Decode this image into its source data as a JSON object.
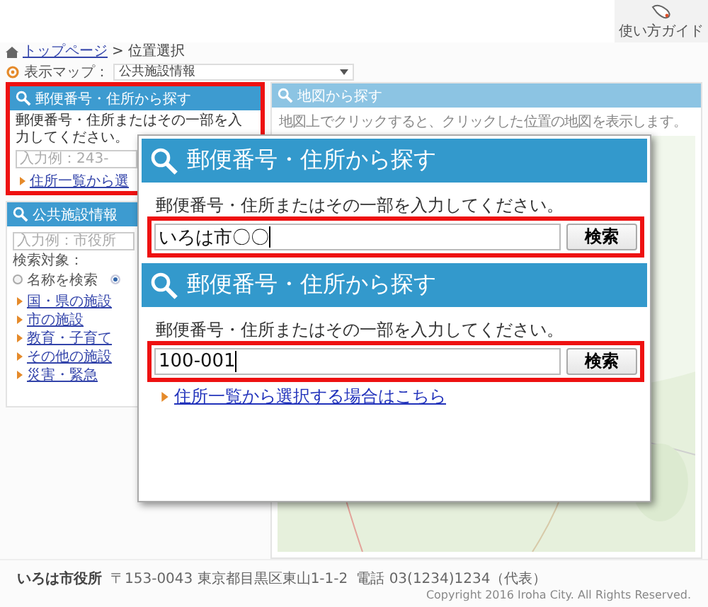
{
  "header": {
    "guide_label": "使い方ガイド"
  },
  "breadcrumb": {
    "link": "トップページ",
    "separator": ">",
    "current": "位置選択"
  },
  "map_select": {
    "label": "表示マップ：",
    "value": "公共施設情報"
  },
  "address_panel": {
    "title": "郵便番号・住所から探す",
    "instruction": "郵便番号・住所またはその一部を入力してください。",
    "placeholder": "入力例：243-",
    "link": "住所一覧から選",
    "highlighted": true
  },
  "facility_panel": {
    "title": "公共施設情報",
    "placeholder": "入力例：市役所",
    "target_label": "検索対象：",
    "options": [
      {
        "label": "名称を検索",
        "selected": false
      },
      {
        "selected": true
      }
    ],
    "links": [
      "国・県の施設",
      "市の施設",
      "教育・子育て",
      "その他の施設",
      "災害・緊急"
    ]
  },
  "map_panel": {
    "title": "地図から探す",
    "instruction": "地図上でクリックすると、クリックした位置の地図を表示します。"
  },
  "callout": {
    "panels": [
      {
        "title": "郵便番号・住所から探す",
        "instruction": "郵便番号・住所またはその一部を入力してください。",
        "value": "いろは市〇〇",
        "button": "検索",
        "highlighted": true
      },
      {
        "title": "郵便番号・住所から探す",
        "instruction": "郵便番号・住所またはその一部を入力してください。",
        "value": "100-001",
        "button": "検索",
        "highlighted": true,
        "link": "住所一覧から選択する場合はこちら"
      }
    ]
  },
  "footer": {
    "name": "いろは市役所",
    "address": "〒153-0043 東京都目黒区東山1-1-2",
    "phone": "電話 03(1234)1234（代表）",
    "copyright": "Copyright 2016 Iroha City. All Rights Reserved."
  }
}
